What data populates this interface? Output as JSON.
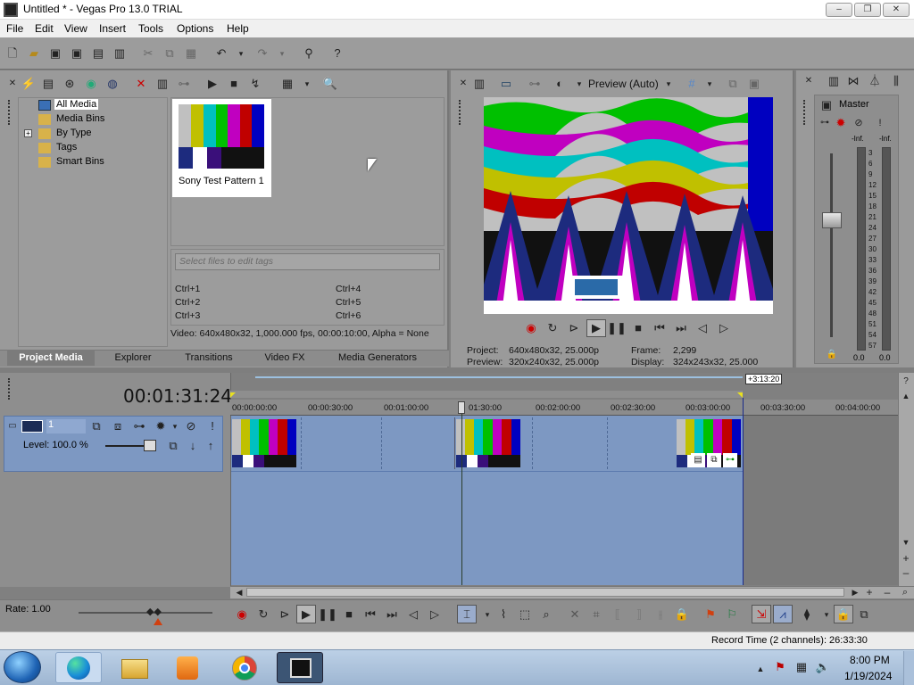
{
  "window": {
    "title": "Untitled * - Vegas Pro 13.0 TRIAL"
  },
  "menu": [
    "File",
    "Edit",
    "View",
    "Insert",
    "Tools",
    "Options",
    "Help"
  ],
  "project_media": {
    "tree": [
      "All Media",
      "Media Bins",
      "By Type",
      "Tags",
      "Smart Bins"
    ],
    "expand_glyph": "+",
    "thumbnail_label": "Sony Test Pattern 1",
    "tags_placeholder": "Select files to edit tags",
    "shortcuts": [
      "Ctrl+1",
      "Ctrl+4",
      "Ctrl+2",
      "Ctrl+5",
      "Ctrl+3",
      "Ctrl+6"
    ],
    "media_info": "Video: 640x480x32, 1,000.000 fps, 00:00:10:00, Alpha = None"
  },
  "tabs": [
    "Project Media",
    "Explorer",
    "Transitions",
    "Video FX",
    "Media Generators"
  ],
  "preview": {
    "mode": "Preview (Auto)",
    "project_label": "Project:",
    "project_val": "640x480x32, 25.000p",
    "preview_label": "Preview:",
    "preview_val": "320x240x32, 25.000p",
    "frame_label": "Frame:",
    "frame_val": "2,299",
    "display_label": "Display:",
    "display_val": "324x243x32, 25.000"
  },
  "master": {
    "label": "Master",
    "inf_left": "-Inf.",
    "inf_right": "-Inf.",
    "scale": [
      "3",
      "6",
      "9",
      "12",
      "15",
      "18",
      "21",
      "24",
      "27",
      "30",
      "33",
      "36",
      "39",
      "42",
      "45",
      "48",
      "51",
      "54",
      "57"
    ],
    "val_left": "0.0",
    "val_right": "0.0"
  },
  "timeline": {
    "timecode": "00:01:31:24",
    "end_marker": "+3:13:20",
    "ruler": [
      "00:00:00:00",
      "00:00:30:00",
      "00:01:00:00",
      "01:30:00",
      "00:02:00:00",
      "00:02:30:00",
      "00:03:00:00",
      "00:03:30:00",
      "00:04:00:00"
    ],
    "track_number": "1",
    "level_label": "Level: 100.0 %",
    "rate_label": "Rate: 1.00",
    "record_time": "Record Time (2 channels): 26:33:30"
  },
  "taskbar": {
    "time": "8:00 PM",
    "date": "1/19/2024"
  },
  "colors": {
    "title_bg": "#ffffff",
    "panel": "#9a9a9a",
    "track": "#7d98c2",
    "accent_blue": "#2f4fb0"
  }
}
